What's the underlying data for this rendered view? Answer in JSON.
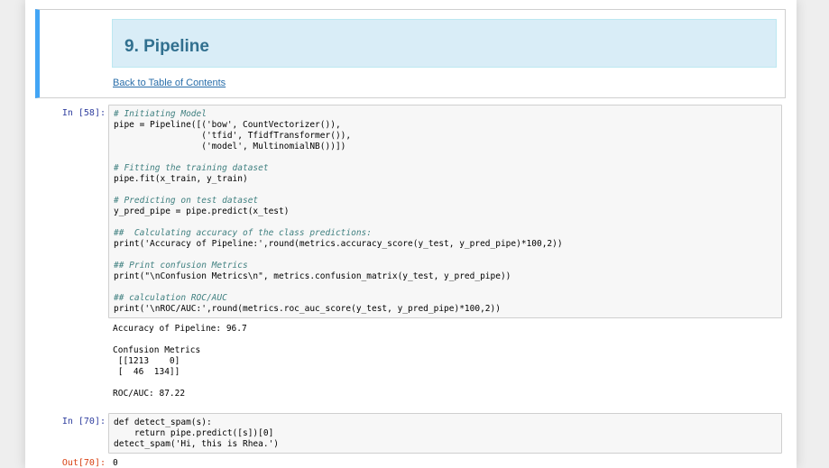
{
  "markdown": {
    "heading": "9. Pipeline",
    "link": "Back to Table of Contents"
  },
  "cell58": {
    "prompt": "In [58]:",
    "code": [
      "# Initiating Model",
      "pipe = Pipeline([('bow', CountVectorizer()),",
      "                 ('tfid', TfidfTransformer()),",
      "                 ('model', MultinomialNB())])",
      "",
      "# Fitting the training dataset",
      "pipe.fit(x_train, y_train)",
      "",
      "# Predicting on test dataset",
      "y_pred_pipe = pipe.predict(x_test)",
      "",
      "##  Calculating accuracy of the class predictions:",
      "print('Accuracy of Pipeline:',round(metrics.accuracy_score(y_test, y_pred_pipe)*100,2))",
      "",
      "## Print confusion Metrics",
      "print(\"\\nConfusion Metrics\\n\", metrics.confusion_matrix(y_test, y_pred_pipe))",
      "",
      "## calculation ROC/AUC",
      "print('\\nROC/AUC:',round(metrics.roc_auc_score(y_test, y_pred_pipe)*100,2))"
    ],
    "output": "Accuracy of Pipeline: 96.7\n\nConfusion Metrics\n [[1213    0]\n [  46  134]]\n\nROC/AUC: 87.22"
  },
  "cell70": {
    "prompt": "In [70]:",
    "code": [
      "def detect_spam(s):",
      "    return pipe.predict([s])[0]",
      "detect_spam('Hi, this is Rhea.')"
    ],
    "out_prompt": "Out[70]:",
    "output": "0"
  }
}
